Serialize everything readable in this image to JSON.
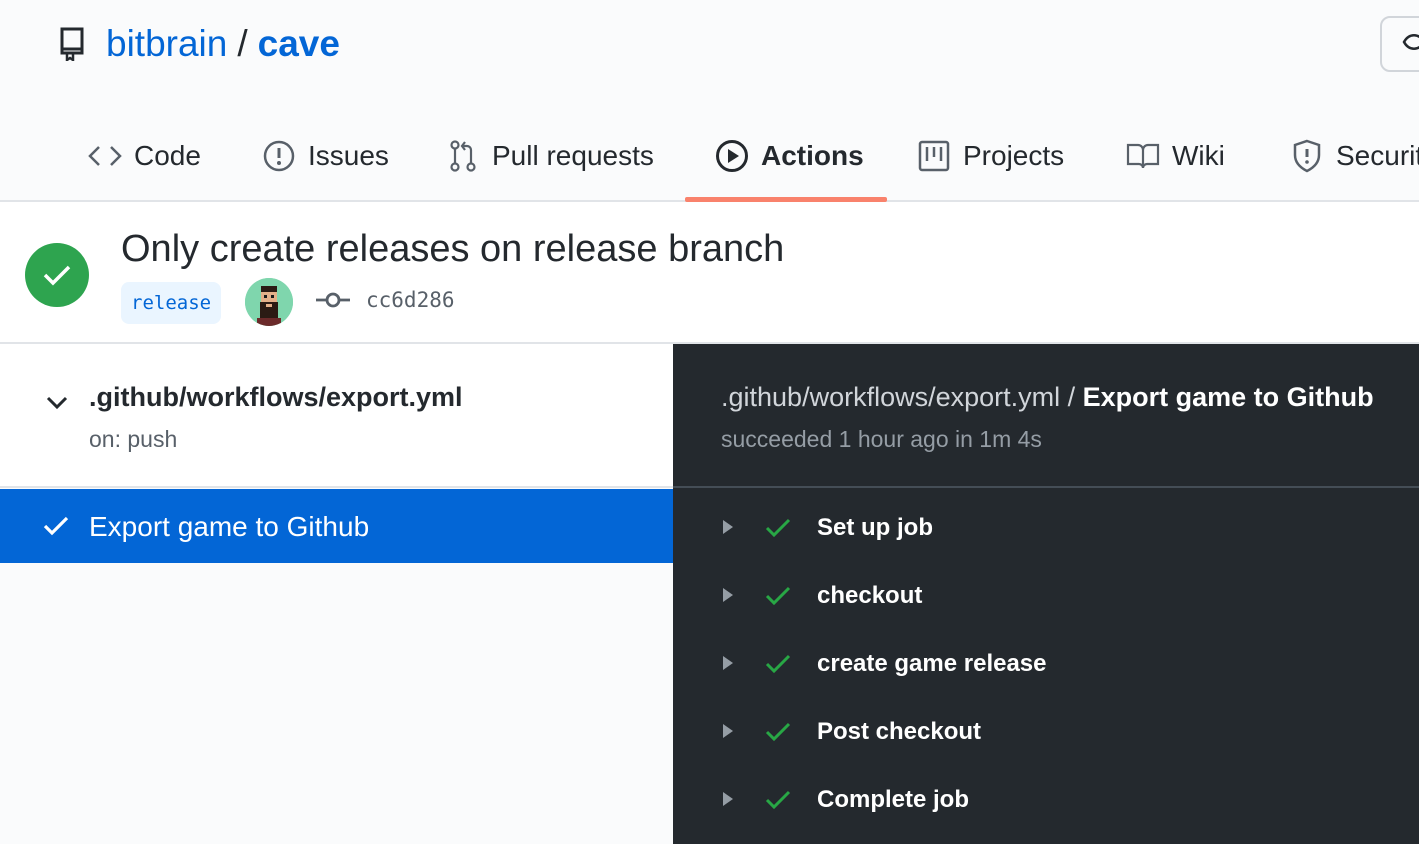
{
  "repo": {
    "owner": "bitbrain",
    "separator": "/",
    "name": "cave"
  },
  "tabs": [
    {
      "label": "Code",
      "icon": "code-icon"
    },
    {
      "label": "Issues",
      "icon": "issue-opened-icon"
    },
    {
      "label": "Pull requests",
      "icon": "git-pull-request-icon"
    },
    {
      "label": "Actions",
      "icon": "play-icon",
      "selected": true
    },
    {
      "label": "Projects",
      "icon": "project-icon"
    },
    {
      "label": "Wiki",
      "icon": "book-icon"
    },
    {
      "label": "Securit",
      "icon": "shield-icon"
    }
  ],
  "run": {
    "title": "Only create releases on release branch",
    "branch": "release",
    "commit_sha": "cc6d286",
    "status_color": "#2ea44f"
  },
  "workflow": {
    "file": ".github/workflows/export.yml",
    "trigger": "on: push",
    "jobs": [
      {
        "name": "Export game to Github",
        "selected": true
      }
    ]
  },
  "log": {
    "path_prefix": ".github/workflows/export.yml /",
    "job_name": "Export game to Github",
    "status_line": "succeeded 1 hour ago in 1m 4s",
    "steps": [
      {
        "label": "Set up job"
      },
      {
        "label": "checkout"
      },
      {
        "label": "create game release"
      },
      {
        "label": "Post checkout"
      },
      {
        "label": "Complete job"
      }
    ]
  },
  "colors": {
    "link": "#0366d6",
    "tab_underline": "#f9826c",
    "success": "#2ea44f",
    "log_bg": "#24292e",
    "selected_job_bg": "#0366d6"
  }
}
